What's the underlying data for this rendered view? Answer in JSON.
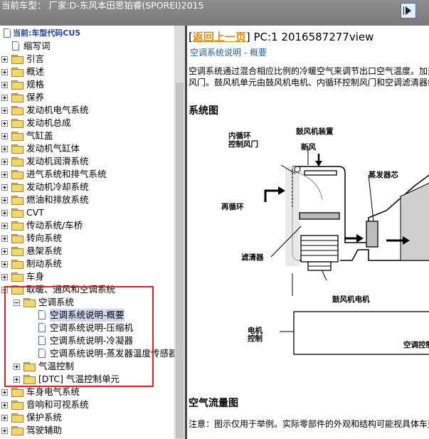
{
  "header": {
    "title": "当前车型：  厂家:D-东风本田思铂睿(SPOREI)2015",
    "nav_icon": "arrow-right-icon"
  },
  "tree": {
    "root": "当前:车型代码CU5",
    "items": [
      "缩写词",
      "引言",
      "概述",
      "规格",
      "保养",
      "发动机电气系统",
      "发动机总成",
      "气缸盖",
      "发动机气缸体",
      "发动机润滑系统",
      "进气系统和排气系统",
      "发动机冷却系统",
      "燃油和排放系统",
      "CVT",
      "传动系统/车桥",
      "转向系统",
      "悬架系统",
      "制动系统",
      "车身",
      "取暖、通风和空调系统",
      "空调系统",
      "空调系统说明-概要",
      "空调系统说明-压缩机",
      "空调系统说明-冷凝器",
      "空调系统说明-蒸发器温度传感器",
      "气温控制",
      "[DTC] 气温控制单元",
      "车身电气系统",
      "音响和可视系统",
      "保护系统",
      "驾驶辅助"
    ]
  },
  "content": {
    "back_link": "返回上一页",
    "page_info": "PC:1 2016587277view",
    "subtitle": "空调系统说明 - 概要",
    "para1_line1": "空调系统通过混合相应比例的冷暖空气来调节出口空气温度。加热",
    "para1_line2": "风门。鼓风机单元由鼓风机电机、内循环控制风门和空调滤清器组",
    "section1": "系统图",
    "section2": "空气流量图",
    "note": "注意：图示仅用于举例。实际零部件的外观和结构可能视具体车型"
  },
  "diagram": {
    "labels": {
      "recirc_door": "内循环\n控制风门",
      "blower_assembly": "鼓风机装置",
      "fresh_air": "新风",
      "evaporator": "蒸发器芯",
      "recirc": "再循环",
      "filter": "滤清器",
      "blower_motor": "鼓风机电机",
      "motor_control": "电机\n控制",
      "ac_control": "空调控制"
    }
  }
}
